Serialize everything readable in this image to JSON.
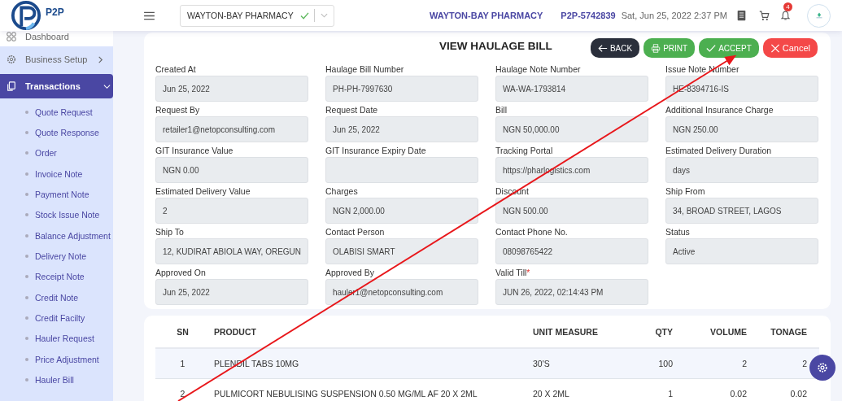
{
  "header": {
    "logo_text": "P2P",
    "pharmacy_select": "WAYTON-BAY PHARMACY",
    "pharmacy_verified": true,
    "company": "WAYTON-BAY PHARMACY",
    "account_id": "P2P-5742839",
    "datetime": "Sat, Jun 25, 2022 2:37 PM",
    "notification_count": "4"
  },
  "sidebar": {
    "items": [
      {
        "label": "Dashboard",
        "selected": false
      },
      {
        "label": "Business Setup",
        "selected": false,
        "expanded": false
      },
      {
        "label": "Transactions",
        "selected": true,
        "expanded": true,
        "children": [
          {
            "label": "Quote Request"
          },
          {
            "label": "Quote Response"
          },
          {
            "label": "Order"
          },
          {
            "label": "Invoice Note"
          },
          {
            "label": "Payment Note"
          },
          {
            "label": "Stock Issue Note"
          },
          {
            "label": "Balance Adjustment"
          },
          {
            "label": "Delivery Note"
          },
          {
            "label": "Receipt Note"
          },
          {
            "label": "Credit Note"
          },
          {
            "label": "Credit Facilty"
          },
          {
            "label": "Hauler Request"
          },
          {
            "label": "Price Adjustment"
          },
          {
            "label": "Hauler Bill"
          }
        ]
      }
    ]
  },
  "page": {
    "title": "VIEW HAULAGE BILL",
    "buttons": [
      {
        "label": "BACK",
        "kind": "back"
      },
      {
        "label": "PRINT",
        "kind": "print"
      },
      {
        "label": "ACCEPT",
        "kind": "accept"
      },
      {
        "label": "Cancel",
        "kind": "cancel"
      }
    ],
    "fields": [
      {
        "label": "Created At",
        "value": "Jun 25, 2022"
      },
      {
        "label": "Haulage Bill Number",
        "value": "PH-PH-7997630"
      },
      {
        "label": "Haulage Note Number",
        "value": "WA-WA-1793814"
      },
      {
        "label": "Issue Note Number",
        "value": "HE-8394716-IS"
      },
      {
        "label": "Request By",
        "value": "retailer1@netopconsulting.com"
      },
      {
        "label": "Request Date",
        "value": "Jun 25, 2022"
      },
      {
        "label": "Bill",
        "value": "NGN 50,000.00"
      },
      {
        "label": "Additional Insurance Charge",
        "value": "NGN 250.00"
      },
      {
        "label": "GIT Insurance Value",
        "value": "NGN 0.00"
      },
      {
        "label": "GIT Insurance Expiry Date"
      },
      {
        "label": "Tracking Portal",
        "value": "https://pharlogistics.com"
      },
      {
        "label": "Estimated Delivery Duration",
        "value": "days"
      },
      {
        "label": "Estimated Delivery Value",
        "value": "2"
      },
      {
        "label": "Charges",
        "value": "NGN 2,000.00"
      },
      {
        "label": "Discount",
        "value": "NGN 500.00"
      },
      {
        "label": "Ship From",
        "value": "34, BROAD STREET, LAGOS"
      },
      {
        "label": "Ship To",
        "value": "12, KUDIRAT ABIOLA WAY, OREGUN"
      },
      {
        "label": "Contact Person",
        "value": "OLABISI SMART"
      },
      {
        "label": "Contact Phone No.",
        "value": "08098765422"
      },
      {
        "label": "Status",
        "value": "Active"
      },
      {
        "label": "Approved On",
        "value": "Jun 25, 2022"
      },
      {
        "label": "Approved By",
        "value": "hauler1@netopconsulting.com"
      },
      {
        "label": "Valid Till",
        "value": "JUN 26, 2022,  02:14:43 PM",
        "required_mark": "*"
      }
    ]
  },
  "table": {
    "columns": [
      "SN",
      "PRODUCT",
      "UNIT MEASURE",
      "QTY",
      "VOLUME",
      "TONAGE"
    ],
    "rows": [
      [
        "1",
        "PLENDIL TABS 10MG",
        "30'S",
        "100",
        "2",
        "2"
      ],
      [
        "2",
        "PULMICORT NEBULISING SUSPENSION 0.50 MG/ML AF 20 X 2ML",
        "20 X 2ML",
        "1",
        "0.02",
        "0.02"
      ]
    ]
  },
  "annotations": [
    {
      "kind": "arrow"
    }
  ]
}
